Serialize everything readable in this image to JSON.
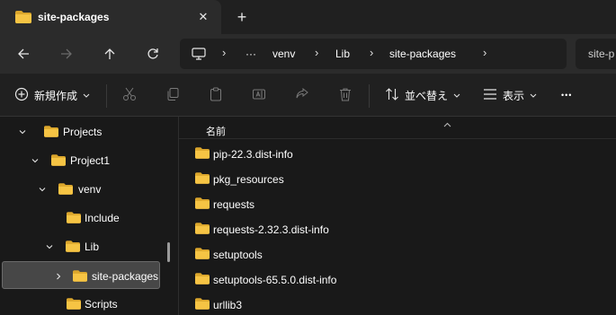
{
  "tab": {
    "title": "site-packages",
    "close": "✕",
    "new": "+"
  },
  "navbar": {
    "breadcrumbs": [
      "venv",
      "Lib",
      "site-packages"
    ],
    "overflow": "···",
    "search_text": "site-p"
  },
  "commandbar": {
    "new_label": "新規作成",
    "sort_label": "並べ替え",
    "view_label": "表示",
    "more": "•••"
  },
  "tree": [
    {
      "label": "Projects",
      "expanded": true
    },
    {
      "label": "Project1",
      "expanded": true
    },
    {
      "label": "venv",
      "expanded": true
    },
    {
      "label": "Include",
      "expanded": false
    },
    {
      "label": "Lib",
      "expanded": true
    },
    {
      "label": "site-packages",
      "expanded": false,
      "selected": true
    },
    {
      "label": "Scripts",
      "expanded": false
    }
  ],
  "filelist": {
    "column_name": "名前",
    "items": [
      "pip-22.3.dist-info",
      "pkg_resources",
      "requests",
      "requests-2.32.3.dist-info",
      "setuptools",
      "setuptools-65.5.0.dist-info",
      "urllib3"
    ]
  },
  "colors": {
    "folder": "#f6c444",
    "folder_dark": "#dba62c",
    "accent_bg": "#2b2b2b",
    "window_bg": "#191919"
  }
}
